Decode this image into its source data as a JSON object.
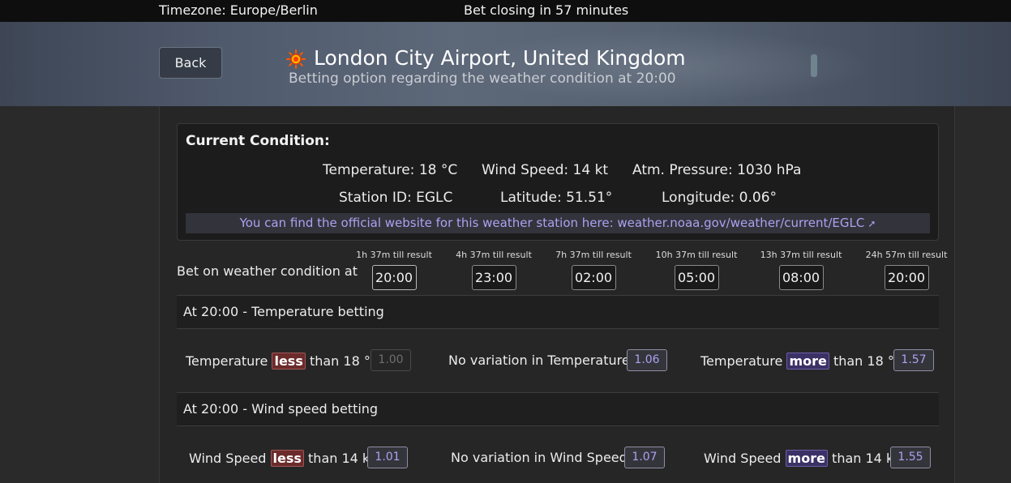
{
  "topbar": {
    "timezone": "Timezone: Europe/Berlin",
    "closing": "Bet closing in 57 minutes"
  },
  "header": {
    "back_label": "Back",
    "icon": "sun-icon",
    "title": "London City Airport, United Kingdom",
    "subtitle": "Betting option regarding the weather condition at 20:00"
  },
  "condition": {
    "heading": "Current Condition:",
    "temperature": "Temperature: 18 °C",
    "wind_speed": "Wind Speed: 14 kt",
    "pressure": "Atm. Pressure: 1030 hPa",
    "station": "Station ID: EGLC",
    "latitude": "Latitude: 51.51°",
    "longitude": "Longitude: 0.06°",
    "link_text": "You can find the official website for this weather station here: weather.noaa.gov/weather/current/EGLC",
    "link_icon": "external-link-icon"
  },
  "schedule": {
    "label": "Bet on weather condition at",
    "slots": [
      {
        "till": "1h 37m till result",
        "time": "20:00"
      },
      {
        "till": "4h 37m till result",
        "time": "23:00"
      },
      {
        "till": "7h 37m till result",
        "time": "02:00"
      },
      {
        "till": "10h 37m till result",
        "time": "05:00"
      },
      {
        "till": "13h 37m till result",
        "time": "08:00"
      },
      {
        "till": "24h 57m till result",
        "time": "20:00"
      }
    ]
  },
  "temperature_betting": {
    "title": "At 20:00 - Temperature betting",
    "less_pre": "Temperature",
    "less_tag": "less",
    "less_post": "than 18 °C",
    "less_odd": "1.00",
    "nochange": "No variation in Temperature",
    "nochange_odd": "1.06",
    "more_pre": "Temperature",
    "more_tag": "more",
    "more_post": "than 18 °C",
    "more_odd": "1.57"
  },
  "wind_betting": {
    "title": "At 20:00 - Wind speed betting",
    "less_pre": "Wind Speed",
    "less_tag": "less",
    "less_post": "than 14 kt",
    "less_odd": "1.01",
    "nochange": "No variation in Wind Speed",
    "nochange_odd": "1.07",
    "more_pre": "Wind Speed",
    "more_tag": "more",
    "more_post": "than 14 kt",
    "more_odd": "1.55"
  },
  "colors": {
    "page_bg": "#2a2a2a",
    "less_tag": "#6b2b2b",
    "more_tag": "#3b3166",
    "link": "#a9a3f0"
  }
}
